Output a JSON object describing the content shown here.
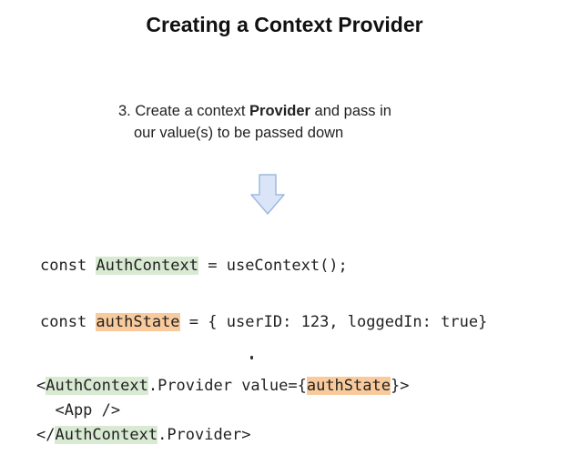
{
  "slide": {
    "title": "Creating a Context Provider",
    "step": {
      "number": "3.",
      "text_before": " Create a context ",
      "bold": "Provider",
      "text_after": " and pass in",
      "line2": "our value(s) to be passed down"
    },
    "arrow_icon": "down-arrow-icon",
    "colors": {
      "context_highlight": "#d9ead3",
      "state_highlight": "#f9cb9c",
      "arrow_fill": "#dae6f7",
      "arrow_stroke": "#9fb8e0"
    },
    "code": {
      "line1": {
        "prefix": "const ",
        "name": "AuthContext",
        "suffix": " = useContext();"
      },
      "line2": {
        "prefix": "const ",
        "name": "authState",
        "suffix": " = { userID: 123, loggedIn: true}"
      },
      "line3": {
        "open": "<",
        "ctx": "AuthContext",
        "middle": ".Provider value={",
        "state": "authState",
        "close": "}>"
      },
      "line4": "  <App />",
      "line5": {
        "open": "</",
        "ctx": "AuthContext",
        "close": ".Provider>"
      }
    }
  }
}
